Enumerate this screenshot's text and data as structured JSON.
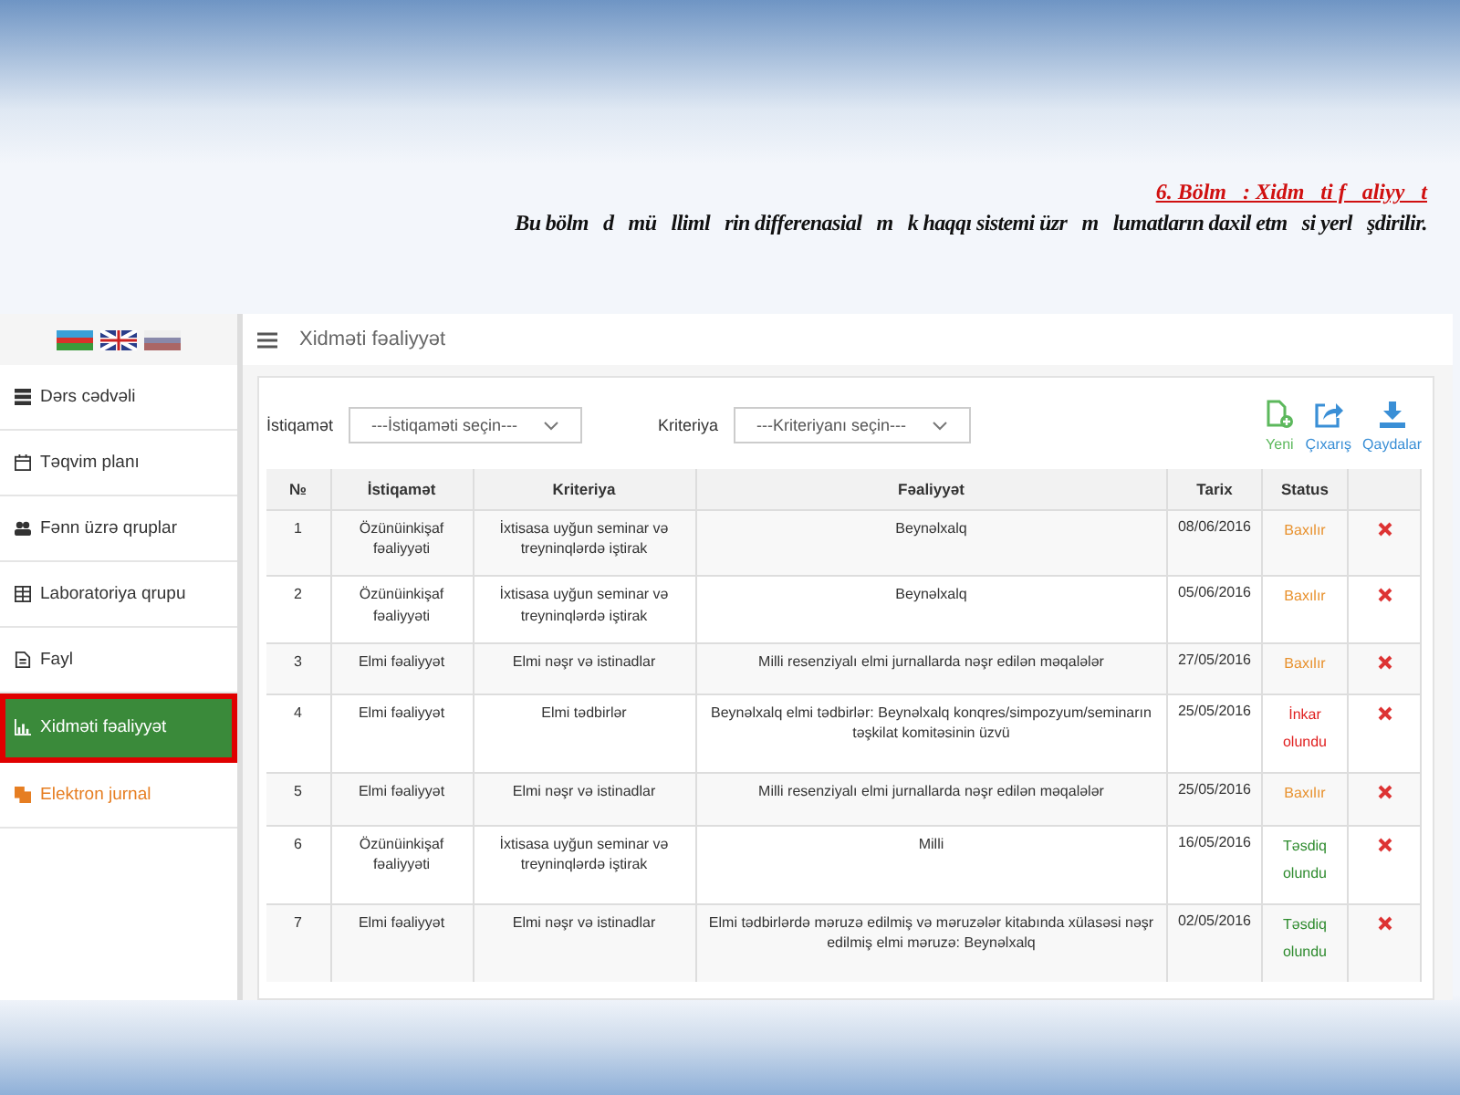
{
  "slide": {
    "title": "6. Bölm   : Xidm   ti f   aliyy   t",
    "subtitle": "Bu bölm   d   mü   lliml   rin differenasial   m   k haqqı sistemi üzr   m   lumatların daxil etm   si yerl   şdirilir."
  },
  "sidebar": {
    "flags": [
      {
        "kind": "az"
      },
      {
        "kind": "uk"
      },
      {
        "kind": "ru"
      }
    ],
    "items": [
      {
        "label": "Dərs cədvəli",
        "kind": "page",
        "selected": false
      },
      {
        "label": "Təqvim planı",
        "kind": "page",
        "selected": false
      },
      {
        "label": "Fənn üzrə qruplar",
        "kind": "page",
        "selected": false
      },
      {
        "label": "Laboratoriya qrupu",
        "kind": "page",
        "selected": false
      },
      {
        "label": "Fayl",
        "kind": "page",
        "selected": false
      },
      {
        "label": "Xidməti fəaliyyət",
        "kind": "page",
        "selected": true
      },
      {
        "label": "Elektron jurnal",
        "kind": "external",
        "selected": false
      }
    ]
  },
  "header": {
    "title": "Xidməti fəaliyyət"
  },
  "filters": [
    {
      "label": "İstiqamət",
      "placeholder": "---İstiqaməti seçin---"
    },
    {
      "label": "Kriteriya",
      "placeholder": "---Kriteriyanı seçin---"
    }
  ],
  "actions": [
    {
      "label": "Yeni",
      "kind": "new"
    },
    {
      "label": "Çıxarış",
      "kind": "export"
    },
    {
      "label": "Qaydalar",
      "kind": "download"
    }
  ],
  "table": {
    "columns": [
      "№",
      "İstiqamət",
      "Kriteriya",
      "Fəaliyyət",
      "Tarix",
      "Status"
    ],
    "rows": [
      {
        "cells": [
          "1",
          "Özünüinkişaf fəaliyyəti",
          "İxtisasa uyğun seminar və treyninqlərdə iştirak",
          "Beynəlxalq",
          "08/06/2016"
        ],
        "status": "Baxılır",
        "kind": "pending"
      },
      {
        "cells": [
          "2",
          "Özünüinkişaf fəaliyyəti",
          "İxtisasa uyğun seminar və treyninqlərdə iştirak",
          "Beynəlxalq",
          "05/06/2016"
        ],
        "status": "Baxılır",
        "kind": "pending"
      },
      {
        "cells": [
          "3",
          "Elmi fəaliyyət",
          "Elmi nəşr və istinadlar",
          "Milli resenziyalı elmi jurnallarda nəşr edilən məqalələr",
          "27/05/2016"
        ],
        "status": "Baxılır",
        "kind": "pending"
      },
      {
        "cells": [
          "4",
          "Elmi fəaliyyət",
          "Elmi tədbirlər",
          "Beynəlxalq elmi tədbirlər: Beynəlxalq konqres/simpozyum/seminarın təşkilat komitəsinin üzvü",
          "25/05/2016"
        ],
        "status": "İnkar olundu",
        "kind": "rejected"
      },
      {
        "cells": [
          "5",
          "Elmi fəaliyyət",
          "Elmi nəşr və istinadlar",
          "Milli resenziyalı elmi jurnallarda nəşr edilən məqalələr",
          "25/05/2016"
        ],
        "status": "Baxılır",
        "kind": "pending"
      },
      {
        "cells": [
          "6",
          "Özünüinkişaf fəaliyyəti",
          "İxtisasa uyğun seminar və treyninqlərdə iştirak",
          "Milli",
          "16/05/2016"
        ],
        "status": "Təsdiq olundu",
        "kind": "approved"
      },
      {
        "cells": [
          "7",
          "Elmi fəaliyyət",
          "Elmi nəşr və istinadlar",
          "Elmi tədbirlərdə məruzə edilmiş və məruzələr kitabında xülasəsi nəşr edilmiş elmi məruzə: Beynəlxalq",
          "02/05/2016"
        ],
        "status": "Təsdiq olundu",
        "kind": "approved"
      }
    ]
  }
}
